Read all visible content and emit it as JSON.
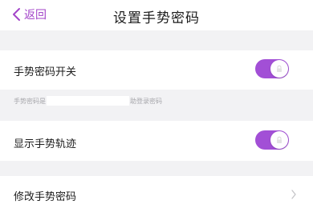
{
  "nav": {
    "back_label": "返回",
    "title": "设置手势密码"
  },
  "settings": {
    "gesture_switch": {
      "label": "手势密码开关",
      "enabled": true
    },
    "hint": {
      "prefix": "手势密码是",
      "suffix": "助登录密码"
    },
    "show_track": {
      "label": "显示手势轨迹",
      "enabled": true
    },
    "modify": {
      "label": "修改手势密码"
    }
  },
  "colors": {
    "accent": "#a24fd6",
    "background": "#f2f2f4"
  }
}
